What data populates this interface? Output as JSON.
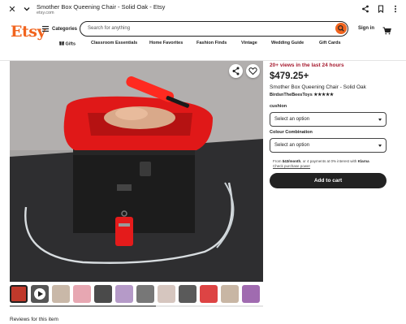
{
  "browser": {
    "title": "Smother Box Queening Chair - Solid Oak - Etsy",
    "url": "etsy.com",
    "icons": [
      "close-icon",
      "chevron-down-icon",
      "share-icon",
      "bookmark-icon",
      "more-vert-icon"
    ]
  },
  "header": {
    "logo": "Etsy",
    "categories_label": "Categories",
    "search_placeholder": "Search for anything",
    "signin_label": "Sign in"
  },
  "nav": {
    "items": [
      "Gifts",
      "Classroom Essentials",
      "Home Favorites",
      "Fashion Finds",
      "Vintage",
      "Wedding Guide",
      "Gift Cards"
    ]
  },
  "listing": {
    "views_badge": "20+ views in the last 24 hours",
    "price": "$479.25+",
    "title": "Smother Box Queening Chair - Solid Oak",
    "shop_name": "BirdsnTheBeesToys",
    "stars": "★★★★★",
    "options": [
      {
        "label": "cushion",
        "value": "Select an option"
      },
      {
        "label": "Colour Combination",
        "value": "Select an option"
      }
    ],
    "klarna_line1_prefix": "From ",
    "klarna_line1_amount": "$43/month",
    "klarna_line1_suffix": ", or 4 payments at 0% interest with ",
    "klarna_brand": "Klarna",
    "klarna_link": "Check purchase power",
    "add_to_cart": "Add to cart"
  },
  "reviews_heading": "Reviews for this item",
  "colors": {
    "accent": "#f1641e",
    "views_red": "#a61a2e",
    "cart_button": "#222222"
  }
}
